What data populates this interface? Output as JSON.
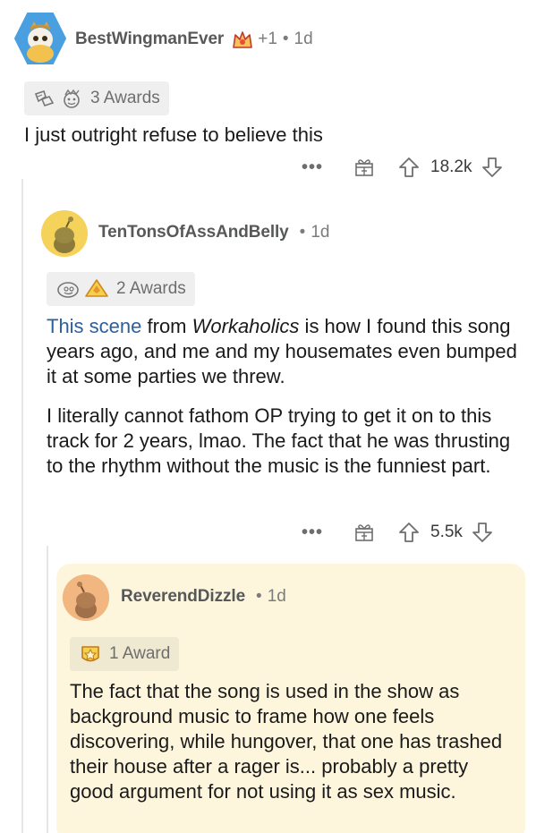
{
  "comment1": {
    "username": "BestWingmanEver",
    "flair_count": "+1",
    "age": "1d",
    "awards_label": "3 Awards",
    "body": "I just outright refuse to believe this",
    "votes": "18.2k"
  },
  "comment2": {
    "username": "TenTonsOfAssAndBelly",
    "age": "1d",
    "awards_label": "2 Awards",
    "link_text": "This scene",
    "para1_a": " from ",
    "para1_italic": "Workaholics",
    "para1_b": " is how I found this song years ago, and me and my housemates even bumped it at some parties we threw.",
    "para2": "I literally cannot fathom OP trying to get it on to this track for 2 years, lmao. The fact that he was thrusting to the rhythm without the music is the funniest part.",
    "votes": "5.5k"
  },
  "comment3": {
    "username": "ReverendDizzle",
    "age": "1d",
    "awards_label": "1 Award",
    "body": "The fact that the song is used in the show as background music to frame how one feels discovering, while hungover, that one has trashed their house after a rager is... probably a pretty good argument for not using it as sex music."
  },
  "ui": {
    "dot": "•",
    "more": "•••"
  },
  "colors": {
    "link": "#2b5f9e",
    "highlight_bg": "#fdf6dc",
    "award_bg": "#efefef"
  }
}
